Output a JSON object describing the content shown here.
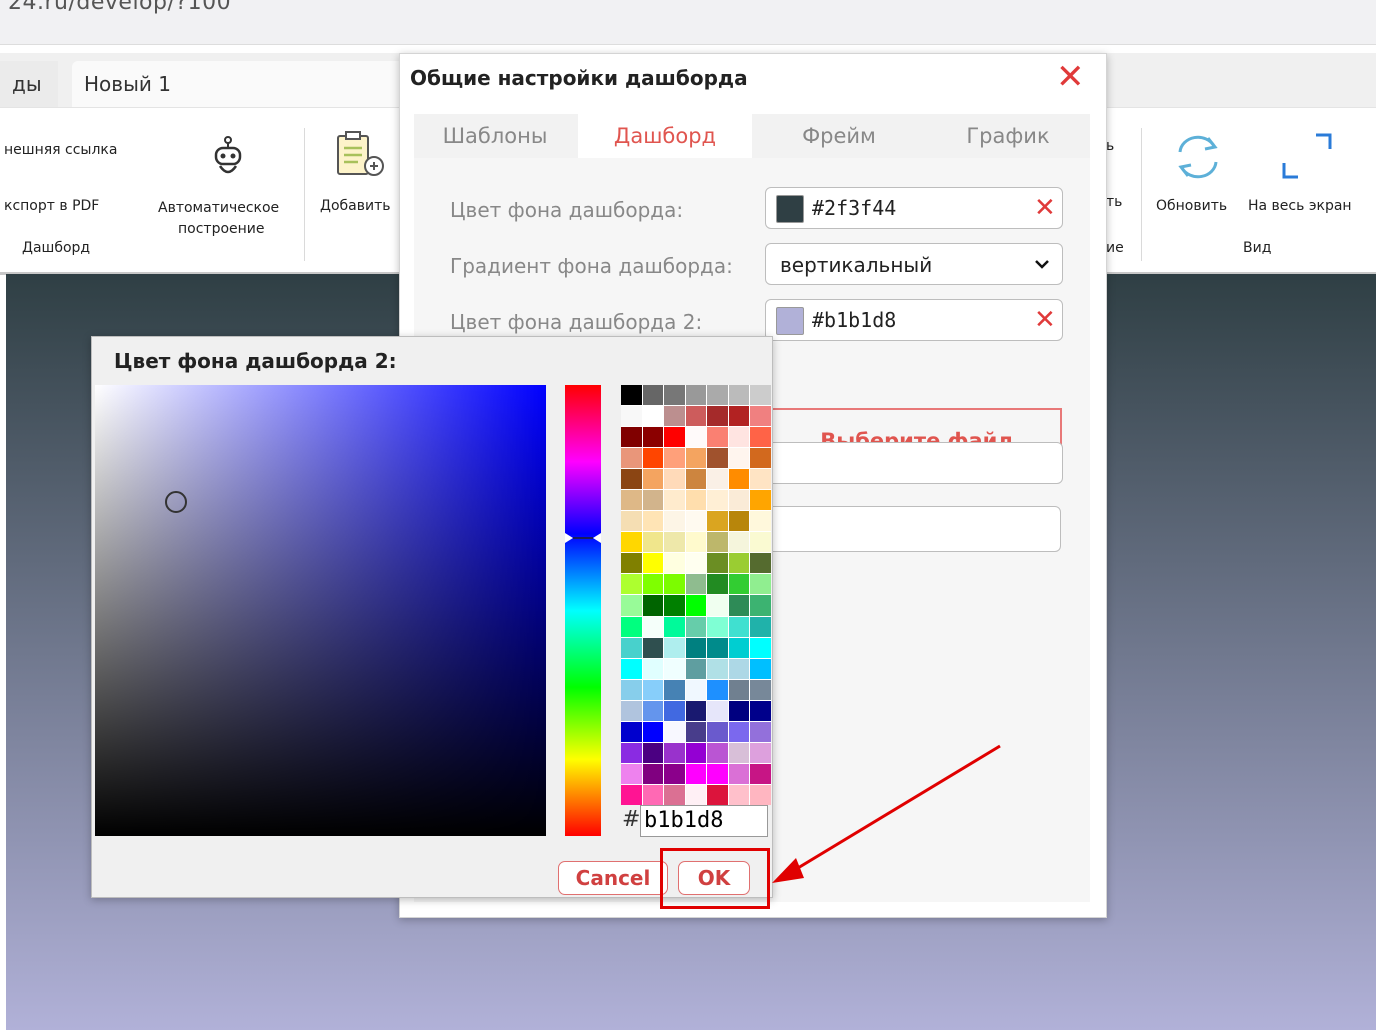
{
  "browser": {
    "url": "24.ru/develop/?100"
  },
  "doc_tabs": [
    {
      "label": "ды"
    },
    {
      "label": "Новый 1"
    }
  ],
  "ribbon": {
    "link_label": "нешняя ссылка",
    "export_label": "кспорт в PDF",
    "dashboard_group": "Дашборд",
    "auto_line1": "Автоматическое",
    "auto_line2": "построение",
    "add_label": "Добавить",
    "partial_1": "ь",
    "partial_2": "ть",
    "partial_3": "ие",
    "refresh_label": "Обновить",
    "fullscreen_label": "На весь экран",
    "view_group": "Вид"
  },
  "settings_dialog": {
    "title": "Общие настройки дашборда",
    "tabs": [
      {
        "label": "Шаблоны"
      },
      {
        "label": "Дашборд"
      },
      {
        "label": "Фрейм"
      },
      {
        "label": "График"
      }
    ],
    "active_tab": "Дашборд",
    "bg_color_label": "Цвет фона дашборда:",
    "bg_color_value": "#2f3f44",
    "gradient_label": "Градиент фона дашборда:",
    "gradient_value": "вертикальный",
    "bg_color2_label": "Цвет фона дашборда 2:",
    "bg_color2_value": "#b1b1d8",
    "file_button": "Выберите файл"
  },
  "color_picker": {
    "title": "Цвет фона дашборда 2:",
    "hex_prefix": "#",
    "hex_value": "b1b1d8",
    "cancel_label": "Cancel",
    "ok_label": "OK",
    "palette": [
      "#000000",
      "#666666",
      "#777777",
      "#999999",
      "#aaaaaa",
      "#bbbbbb",
      "#cccccc",
      "#f8f8f8",
      "#ffffff",
      "#bc8f8f",
      "#cd5c5c",
      "#a52a2a",
      "#b22222",
      "#f08080",
      "#800000",
      "#8b0000",
      "#ff0000",
      "#fffafa",
      "#fa8072",
      "#ffe4e1",
      "#ff6347",
      "#e9967a",
      "#ff4500",
      "#ffa07a",
      "#f4a460",
      "#a0522d",
      "#fff5ee",
      "#d2691e",
      "#8b4513",
      "#f4a460",
      "#ffdab9",
      "#cd853f",
      "#faf0e6",
      "#ff8c00",
      "#ffe4c4",
      "#deb887",
      "#d2b48c",
      "#ffebcd",
      "#ffdead",
      "#ffefd5",
      "#faebd7",
      "#ffa500",
      "#f5deb3",
      "#ffe4b5",
      "#fdf5e6",
      "#fffaf0",
      "#daa520",
      "#b8860b",
      "#fff8dc",
      "#ffd700",
      "#f0e68c",
      "#eee8aa",
      "#fffacd",
      "#bdb76b",
      "#f5f5dc",
      "#fafad2",
      "#808000",
      "#ffff00",
      "#ffffe0",
      "#fffff0",
      "#6b8e23",
      "#9acd32",
      "#556b2f",
      "#adff2f",
      "#7fff00",
      "#7cfc00",
      "#8fbc8f",
      "#228b22",
      "#32cd32",
      "#90ee90",
      "#98fb98",
      "#006400",
      "#008000",
      "#00ff00",
      "#f0fff0",
      "#2e8b57",
      "#3cb371",
      "#00ff7f",
      "#f5fffa",
      "#00fa9a",
      "#66cdaa",
      "#7fffd4",
      "#40e0d0",
      "#20b2aa",
      "#48d1cc",
      "#2f4f4f",
      "#afeeee",
      "#008080",
      "#008b8b",
      "#00ced1",
      "#00ffff",
      "#00ffff",
      "#e0ffff",
      "#f0ffff",
      "#5f9ea0",
      "#b0e0e6",
      "#add8e6",
      "#00bfff",
      "#87ceeb",
      "#87cefa",
      "#4682b4",
      "#f0f8ff",
      "#1e90ff",
      "#708090",
      "#778899",
      "#b0c4de",
      "#6495ed",
      "#4169e1",
      "#191970",
      "#e6e6fa",
      "#000080",
      "#00008b",
      "#0000cd",
      "#0000ff",
      "#f8f8ff",
      "#483d8b",
      "#6a5acd",
      "#7b68ee",
      "#9370db",
      "#8a2be2",
      "#4b0082",
      "#9932cc",
      "#9400d3",
      "#ba55d3",
      "#d8bfd8",
      "#dda0dd",
      "#ee82ee",
      "#800080",
      "#8b008b",
      "#ff00ff",
      "#ff00ff",
      "#da70d6",
      "#c71585",
      "#ff1493",
      "#ff69b4",
      "#db7093",
      "#fff0f5",
      "#dc143c",
      "#ffc0cb",
      "#ffb6c1"
    ]
  }
}
